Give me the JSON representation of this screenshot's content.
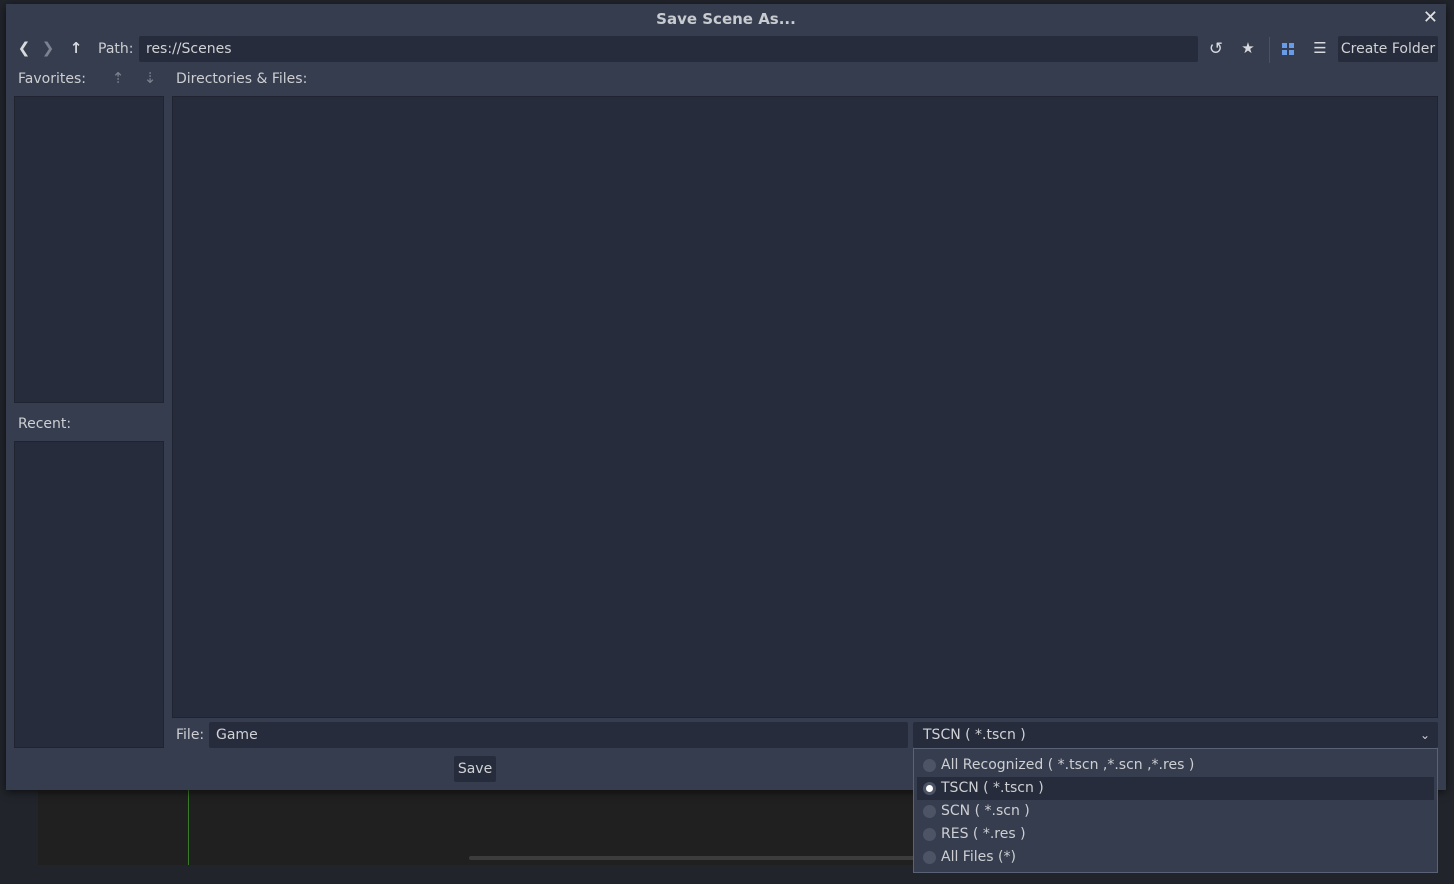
{
  "dialog": {
    "title": "Save Scene As..."
  },
  "toolbar": {
    "path_label": "Path:",
    "path_value": "res://Scenes",
    "create_folder": "Create Folder"
  },
  "favorites": {
    "label": "Favorites:"
  },
  "recent": {
    "label": "Recent:"
  },
  "files": {
    "label": "Directories & Files:"
  },
  "file_field": {
    "label": "File:",
    "value": "Game"
  },
  "filter": {
    "selected": "TSCN ( *.tscn )",
    "options": [
      "All Recognized ( *.tscn ,*.scn ,*.res  )",
      "TSCN ( *.tscn )",
      "SCN ( *.scn )",
      "RES ( *.res )",
      "All Files (*)"
    ]
  },
  "save_label": "Save",
  "colors": {
    "accent": "#699ce8",
    "background": "#363d4e",
    "panel": "#262c3b"
  }
}
